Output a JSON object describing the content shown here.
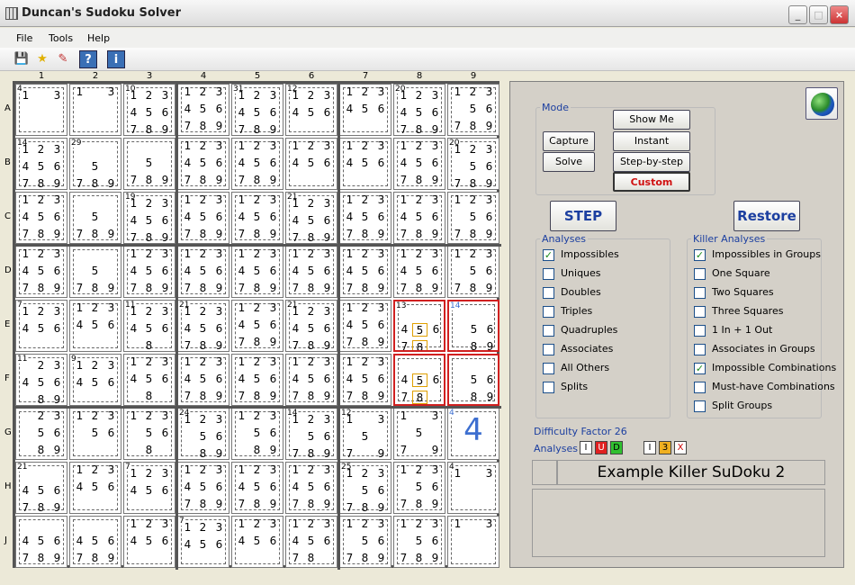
{
  "window": {
    "title": "Duncan's Sudoku Solver",
    "minimize": "_",
    "maximize": "□",
    "close": "×"
  },
  "menu": {
    "file": "File",
    "tools": "Tools",
    "help": "Help"
  },
  "toolbar": {
    "save": "💾",
    "star": "★",
    "edit": "✎",
    "help": "?",
    "info": "i"
  },
  "grid": {
    "cols": [
      "1",
      "2",
      "3",
      "4",
      "5",
      "6",
      "7",
      "8",
      "9"
    ],
    "rows": [
      "A",
      "B",
      "C",
      "D",
      "E",
      "F",
      "G",
      "H",
      "J"
    ],
    "cells": [
      [
        "1 . 3",
        "1 . 3",
        "123456789",
        "123456789",
        "123456789",
        "123456",
        "123456",
        "123456789",
        "12356789"
      ],
      [
        "123456789",
        "5789",
        "5789",
        "123456789",
        "123456789",
        "123456",
        "123456",
        "123456789",
        "12356789"
      ],
      [
        "123456789",
        "5789",
        "123456789",
        "123456789",
        "123456789",
        "123456789",
        "123456789",
        "123456789",
        "12356789"
      ],
      [
        "123456789",
        "5789",
        "123456789",
        "123456789",
        "123456789",
        "123456789",
        "123456789",
        "123456789",
        "12356789"
      ],
      [
        "123456",
        "123456",
        "1234568",
        "123456789",
        "123456789",
        "123456789",
        "123456789",
        "45678",
        "5689"
      ],
      [
        "2345689",
        "123456",
        "1234568",
        "123456789",
        "123456789",
        "123456789",
        "123456789",
        "45678",
        "5689"
      ],
      [
        "235689",
        "12356",
        "123568",
        "1235689",
        "1235689",
        "12356789",
        "1 . 3 5 7 9",
        "1 . 3 5 7 9",
        "4"
      ],
      [
        "456789",
        "123456",
        "123456",
        "123456789",
        "123456789",
        "123456789",
        "12356789",
        "12356789",
        "1 . 3"
      ],
      [
        "456789",
        "456789",
        "123456",
        "123456",
        "123456",
        "12345678",
        "12356789",
        "12356789",
        "1 . 3"
      ]
    ],
    "cages": [
      [
        "4",
        "",
        "10",
        "",
        "31",
        "12",
        "",
        "20",
        ""
      ],
      [
        "14",
        "29",
        "",
        "",
        "",
        "",
        "",
        "",
        "20"
      ],
      [
        "",
        "",
        "19",
        "",
        "",
        "21",
        "",
        "",
        ""
      ],
      [
        "",
        "",
        "",
        "",
        "",
        "",
        "",
        "",
        ""
      ],
      [
        "7",
        "",
        "11",
        "21",
        "",
        "21",
        "",
        "13",
        "14"
      ],
      [
        "11",
        "9",
        "",
        "",
        "",
        "",
        "",
        "",
        ""
      ],
      [
        "",
        "",
        "",
        "24",
        "",
        "14",
        "12",
        "",
        "4"
      ],
      [
        "21",
        "",
        "7",
        "",
        "",
        "",
        "25",
        "",
        "4"
      ],
      [
        "",
        "",
        "",
        "7",
        "",
        "",
        "",
        "",
        ""
      ]
    ],
    "solved_value": "4"
  },
  "panel": {
    "mode": {
      "legend": "Mode",
      "capture": "Capture",
      "solve": "Solve",
      "show_me": "Show Me",
      "instant": "Instant",
      "step_by_step": "Step-by-step",
      "custom": "Custom"
    },
    "step": "STEP",
    "restore": "Restore",
    "analyses": {
      "legend": "Analyses",
      "items": [
        {
          "label": "Impossibles",
          "checked": true
        },
        {
          "label": "Uniques",
          "checked": false
        },
        {
          "label": "Doubles",
          "checked": false
        },
        {
          "label": "Triples",
          "checked": false
        },
        {
          "label": "Quadruples",
          "checked": false
        },
        {
          "label": "Associates",
          "checked": false
        },
        {
          "label": "All Others",
          "checked": false
        },
        {
          "label": "Splits",
          "checked": false
        }
      ]
    },
    "killer": {
      "legend": "Killer Analyses",
      "items": [
        {
          "label": "Impossibles in Groups",
          "checked": true
        },
        {
          "label": "One Square",
          "checked": false
        },
        {
          "label": "Two Squares",
          "checked": false
        },
        {
          "label": "Three Squares",
          "checked": false
        },
        {
          "label": "1 In + 1 Out",
          "checked": false
        },
        {
          "label": "Associates in Groups",
          "checked": false
        },
        {
          "label": "Impossible Combinations",
          "checked": true
        },
        {
          "label": "Must-have Combinations",
          "checked": false
        },
        {
          "label": "Split Groups",
          "checked": false
        }
      ]
    },
    "difficulty": "Difficulty Factor 26",
    "analyses_label": "Analyses",
    "analysis_boxes": [
      {
        "t": "I",
        "bg": "#ffffff",
        "fg": "#000"
      },
      {
        "t": "U",
        "bg": "#e02020",
        "fg": "#fff"
      },
      {
        "t": "D",
        "bg": "#30c030",
        "fg": "#000"
      },
      {
        "t": "I",
        "bg": "#ffffff",
        "fg": "#000"
      },
      {
        "t": "3",
        "bg": "#f0b020",
        "fg": "#000"
      },
      {
        "t": "X",
        "bg": "#ffffff",
        "fg": "#c00"
      }
    ],
    "puzzle_name": "Example Killer SuDoku 2",
    "check": "✓"
  }
}
